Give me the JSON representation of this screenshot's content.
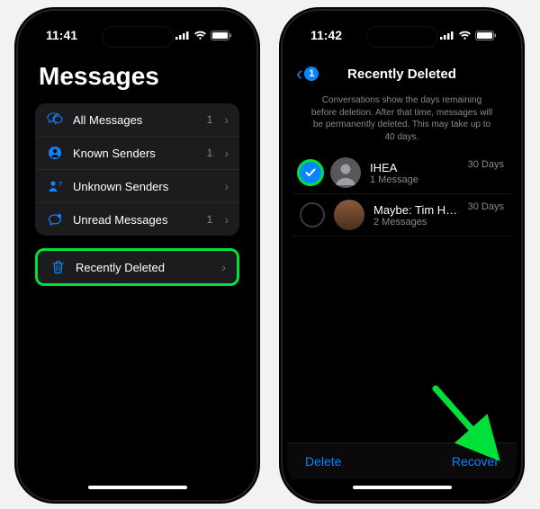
{
  "left": {
    "status_time": "11:41",
    "title": "Messages",
    "filters": [
      {
        "icon": "bubbles",
        "label": "All Messages",
        "count": "1"
      },
      {
        "icon": "person",
        "label": "Known Senders",
        "count": "1"
      },
      {
        "icon": "person-q",
        "label": "Unknown Senders",
        "count": ""
      },
      {
        "icon": "bubble-dot",
        "label": "Unread Messages",
        "count": "1"
      }
    ],
    "recently_deleted_label": "Recently Deleted"
  },
  "right": {
    "status_time": "11:42",
    "back_count": "1",
    "nav_title": "Recently Deleted",
    "info_text": "Conversations show the days remaining before deletion. After that time, messages will be permanently deleted. This may take up to 40 days.",
    "conversations": [
      {
        "selected": true,
        "name": "IHEA",
        "sub": "1 Message",
        "days": "30 Days",
        "avatar": "default"
      },
      {
        "selected": false,
        "name": "Maybe: Tim Hardwick",
        "sub": "2 Messages",
        "days": "30 Days",
        "avatar": "person"
      }
    ],
    "toolbar": {
      "delete": "Delete",
      "recover": "Recover"
    }
  }
}
